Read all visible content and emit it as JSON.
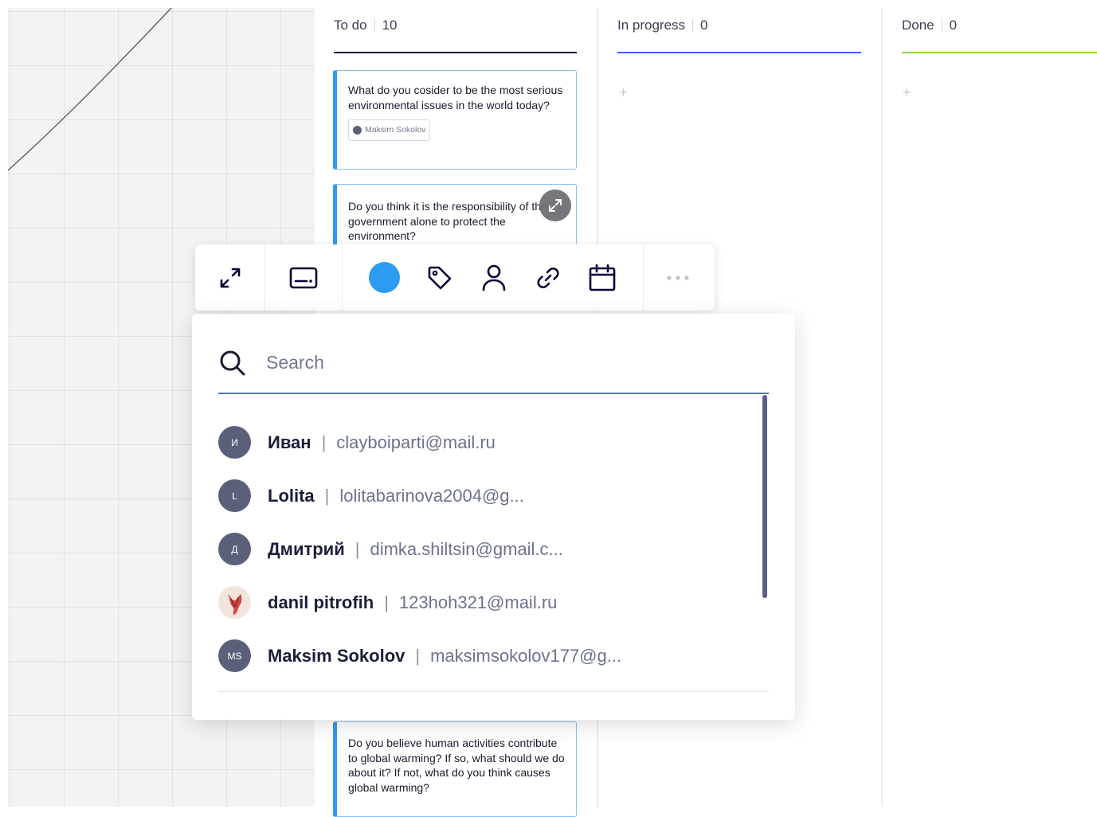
{
  "columns": [
    {
      "title": "To do",
      "count": "10",
      "color": "#1a1a2e"
    },
    {
      "title": "In progress",
      "count": "0",
      "color": "#4262ff",
      "add": "+"
    },
    {
      "title": "Done",
      "count": "0",
      "color": "#8fd14f",
      "add": "+"
    }
  ],
  "cards": [
    {
      "text": "What do you cosider to be the most serious environmental issues in the world today?",
      "assignee": "Maksim Sokolov"
    },
    {
      "text": "Do you think it is the responsibility of the government alone to protect the environment?"
    },
    {
      "text": "Do you believe human activities contribute to global warming? If so, what should we do about it? If not, what do you think causes global warming?"
    }
  ],
  "toolbar": {
    "selected_color": "#2d9bf0",
    "icons": [
      "expand-icon",
      "card-icon",
      "color-icon",
      "tag-icon",
      "assignee-icon",
      "link-icon",
      "calendar-icon",
      "more-icon"
    ]
  },
  "search": {
    "placeholder": "Search"
  },
  "users": [
    {
      "initials": "И",
      "name": "Иван",
      "email": "clayboiparti@mail.ru"
    },
    {
      "initials": "L",
      "name": "Lolita",
      "email": "lolitabarinova2004@g..."
    },
    {
      "initials": "Д",
      "name": "Дмитрий",
      "email": "dimka.shiltsin@gmail.c..."
    },
    {
      "initials": "",
      "name": "danil pitrofih",
      "email": "123hoh321@mail.ru"
    },
    {
      "initials": "MS",
      "name": "Maksim Sokolov",
      "email": "maksimsokolov177@g..."
    }
  ],
  "separator": "|"
}
